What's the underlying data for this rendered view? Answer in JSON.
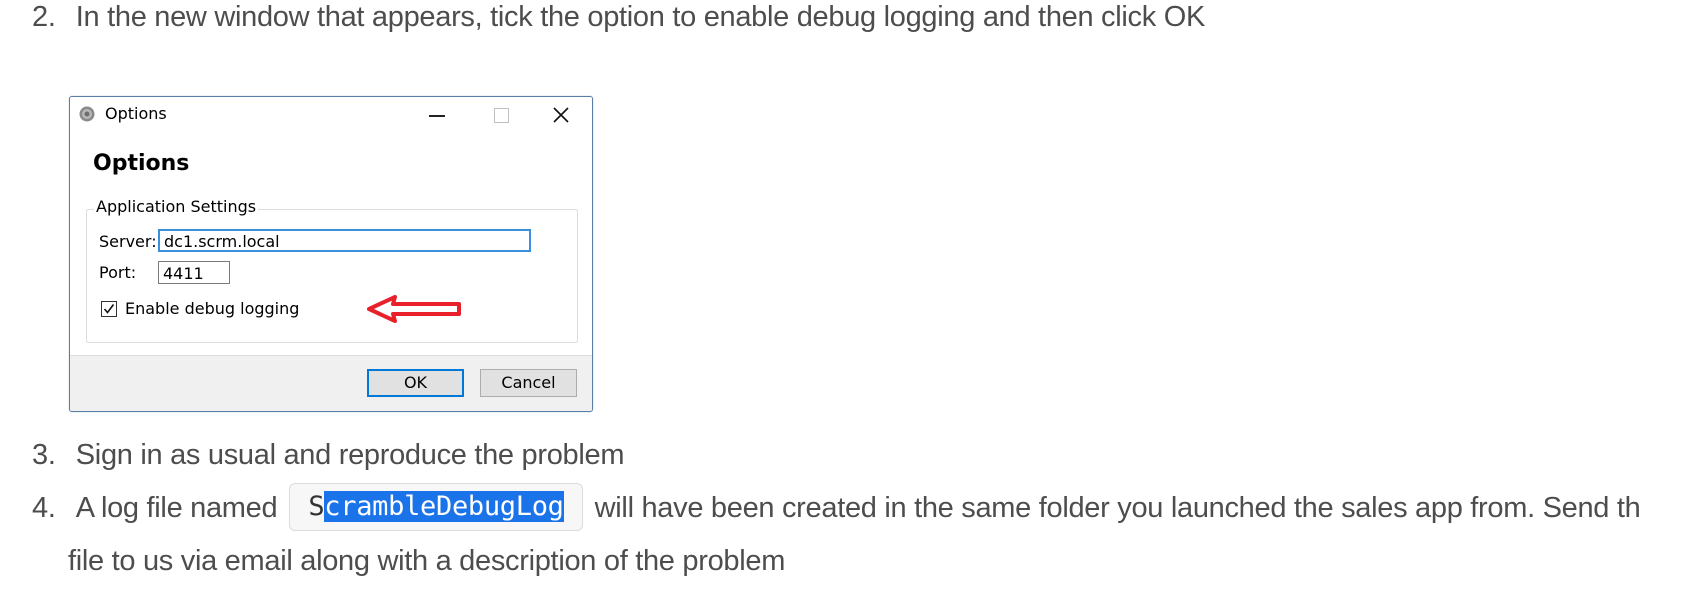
{
  "steps": [
    {
      "number": "2.",
      "text": "In the new window that appears, tick the option to enable debug logging and then click OK"
    },
    {
      "number": "3.",
      "text": "Sign in as usual and reproduce the problem"
    },
    {
      "number": "4.",
      "text_before": "A log file named",
      "code_first_char": "S",
      "code_selected": "crambleDebugLog",
      "text_after": "will have been created in the same folder you launched the sales app from. Send th",
      "continuation": "file to us via email along with a description of the problem"
    }
  ],
  "dialog": {
    "window_title": "Options",
    "heading": "Options",
    "group_label": "Application Settings",
    "server_label": "Server:",
    "server_value": "dc1.scrm.local",
    "port_label": "Port:",
    "port_value": "4411",
    "debug_checkbox_label": "Enable debug logging",
    "debug_checked": true,
    "ok_label": "OK",
    "cancel_label": "Cancel"
  },
  "colors": {
    "selection": "#1a73e8",
    "arrow": "#e8202a",
    "focus_border": "#3c8fdd"
  }
}
